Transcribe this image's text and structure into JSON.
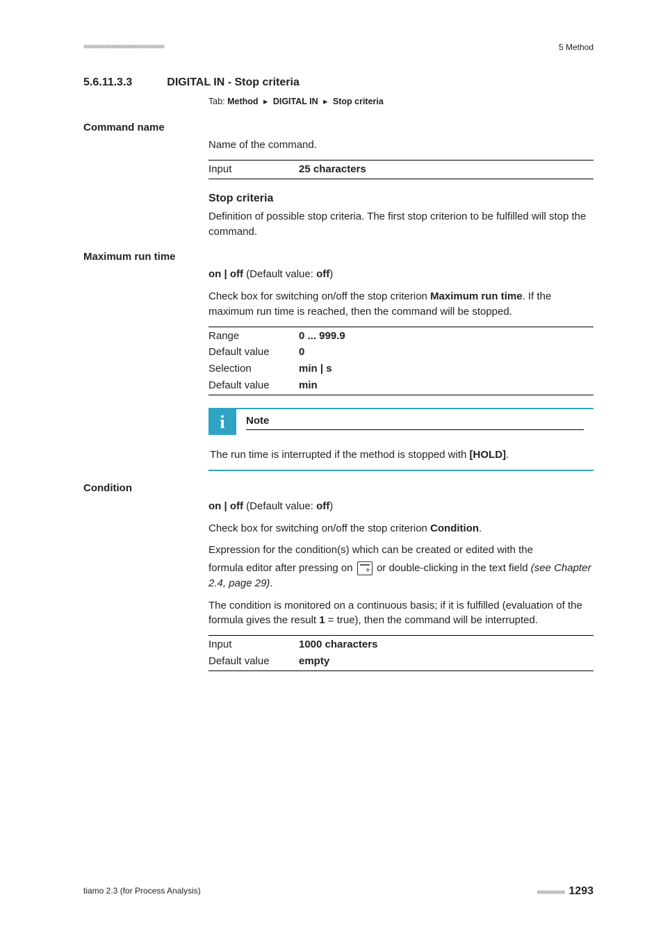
{
  "header": {
    "squares": "■■■■■■■■■■■■■■■■■■■■■■■",
    "right": "5 Method"
  },
  "section": {
    "number": "5.6.11.3.3",
    "title": "DIGITAL IN - Stop criteria"
  },
  "tab": {
    "prefix": "Tab:",
    "parts": [
      "Method",
      "DIGITAL IN",
      "Stop criteria"
    ],
    "sep": "▸"
  },
  "command_name": {
    "label": "Command name",
    "desc": "Name of the command.",
    "input_key": "Input",
    "input_val": "25 characters"
  },
  "stop_criteria": {
    "heading": "Stop criteria",
    "desc": "Definition of possible stop criteria. The first stop criterion to be fulfilled will stop the command."
  },
  "max_run_time": {
    "label": "Maximum run time",
    "toggle_prefix": "on | off",
    "toggle_default_label": " (Default value: ",
    "toggle_default_value": "off",
    "toggle_suffix": ")",
    "desc_pre": "Check box for switching on/off the stop criterion ",
    "desc_bold": "Maximum run time",
    "desc_post": ". If the maximum run time is reached, then the command will be stopped.",
    "rows": [
      {
        "k": "Range",
        "v": "0 ... 999.9"
      },
      {
        "k": "Default value",
        "v": "0"
      },
      {
        "k": "Selection",
        "v": "min | s"
      },
      {
        "k": "Default value",
        "v": "min"
      }
    ]
  },
  "note": {
    "title": "Note",
    "body_pre": "The run time is interrupted if the method is stopped with ",
    "body_bold": "[HOLD]",
    "body_post": "."
  },
  "condition": {
    "label": "Condition",
    "toggle_prefix": "on | off",
    "toggle_default_label": " (Default value: ",
    "toggle_default_value": "off",
    "toggle_suffix": ")",
    "desc1_pre": "Check box for switching on/off the stop criterion ",
    "desc1_bold": "Condition",
    "desc1_post": ".",
    "desc2": "Expression for the condition(s) which can be created or edited with the",
    "desc3_pre": "formula editor after pressing on ",
    "desc3_post": " or double-clicking in the text field ",
    "desc3_ref": "(see Chapter 2.4, page 29)",
    "desc3_tail": ".",
    "desc4_pre": "The condition is monitored on a continuous basis; if it is fulfilled (evaluation of the formula gives the result ",
    "desc4_bold": "1",
    "desc4_post": " = true), then the command will be interrupted.",
    "rows": [
      {
        "k": "Input",
        "v": "1000 characters"
      },
      {
        "k": "Default value",
        "v": "empty"
      }
    ]
  },
  "footer": {
    "left": "tiamo 2.3 (for Process Analysis)",
    "squares": "■■■■■■■■",
    "page": "1293"
  }
}
